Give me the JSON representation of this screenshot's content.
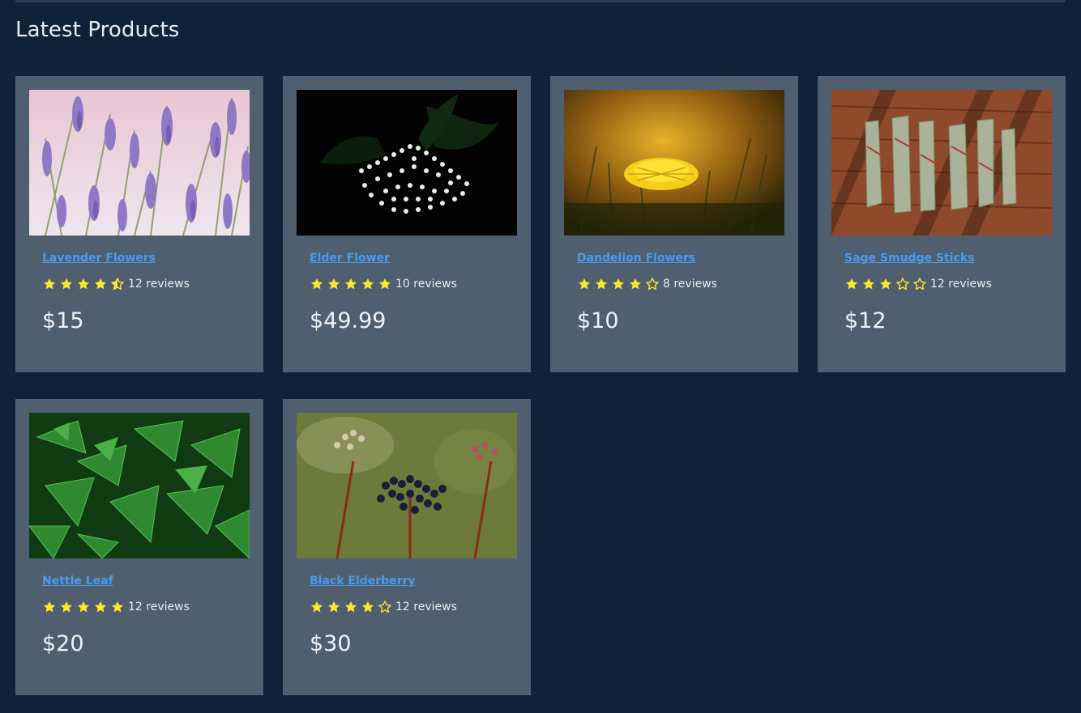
{
  "section": {
    "title": "Latest Products"
  },
  "colors": {
    "page_bg": "#0f2238",
    "card_bg": "#4f5f6f",
    "link": "#4a9bef",
    "star": "#ffe62b",
    "text": "#eef2f6"
  },
  "products": [
    {
      "name": "Lavender Flowers",
      "rating": 4.5,
      "reviews": "12 reviews",
      "price": "$15",
      "image": "lavender"
    },
    {
      "name": "Elder Flower",
      "rating": 5,
      "reviews": "10 reviews",
      "price": "$49.99",
      "image": "elder-flower"
    },
    {
      "name": "Dandelion Flowers",
      "rating": 4,
      "reviews": "8 reviews",
      "price": "$10",
      "image": "dandelion"
    },
    {
      "name": "Sage Smudge Sticks",
      "rating": 3,
      "reviews": "12 reviews",
      "price": "$12",
      "image": "sage"
    },
    {
      "name": "Nettle Leaf",
      "rating": 5,
      "reviews": "12 reviews",
      "price": "$20",
      "image": "nettle"
    },
    {
      "name": "Black Elderberry",
      "rating": 4,
      "reviews": "12 reviews",
      "price": "$30",
      "image": "elderberry"
    }
  ]
}
